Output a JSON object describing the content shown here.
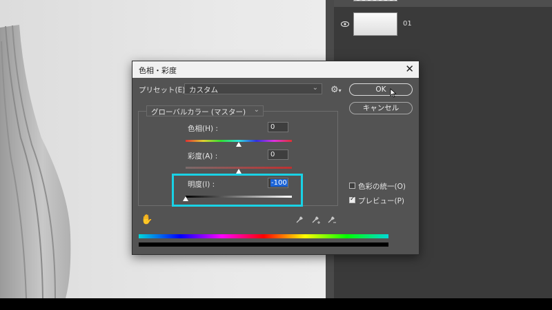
{
  "layers": {
    "row2_name": "01"
  },
  "dialog": {
    "title": "色相・彩度",
    "close_glyph": "✕",
    "preset_label": "プリセット(E) :",
    "preset_value": "カスタム",
    "channel_value": "グローバルカラー (マスター)",
    "hue": {
      "label": "色相(H) :",
      "value": "0"
    },
    "saturation": {
      "label": "彩度(A) :",
      "value": "0"
    },
    "lightness": {
      "label": "明度(I) :",
      "value": "-100"
    },
    "ok_label": "OK",
    "cancel_label": "キャンセル",
    "colorize_label": "色彩の統一(O)",
    "preview_label": "プレビュー(P)",
    "colorize_checked": false,
    "preview_checked": true
  },
  "icons": [
    "eye-icon",
    "gear-icon",
    "close-icon",
    "chevron-down-icon",
    "hand-icon",
    "eyedropper-icon",
    "eyedropper-plus-icon",
    "eyedropper-minus-icon",
    "cursor-arrow-icon"
  ],
  "colors": {
    "highlight": "#19d2e6",
    "dialog_bg": "#535353",
    "panel_bg": "#3a3a3a"
  }
}
